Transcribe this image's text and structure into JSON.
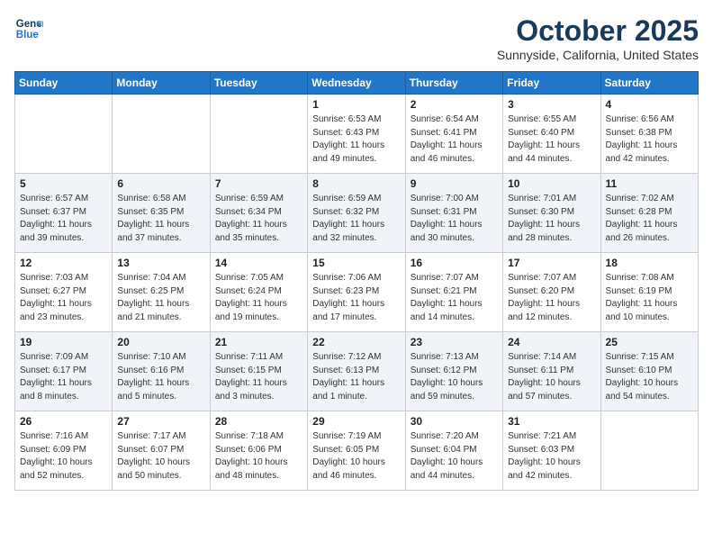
{
  "header": {
    "logo_line1": "General",
    "logo_line2": "Blue",
    "month": "October 2025",
    "location": "Sunnyside, California, United States"
  },
  "days_of_week": [
    "Sunday",
    "Monday",
    "Tuesday",
    "Wednesday",
    "Thursday",
    "Friday",
    "Saturday"
  ],
  "weeks": [
    [
      {
        "day": "",
        "info": ""
      },
      {
        "day": "",
        "info": ""
      },
      {
        "day": "",
        "info": ""
      },
      {
        "day": "1",
        "info": "Sunrise: 6:53 AM\nSunset: 6:43 PM\nDaylight: 11 hours\nand 49 minutes."
      },
      {
        "day": "2",
        "info": "Sunrise: 6:54 AM\nSunset: 6:41 PM\nDaylight: 11 hours\nand 46 minutes."
      },
      {
        "day": "3",
        "info": "Sunrise: 6:55 AM\nSunset: 6:40 PM\nDaylight: 11 hours\nand 44 minutes."
      },
      {
        "day": "4",
        "info": "Sunrise: 6:56 AM\nSunset: 6:38 PM\nDaylight: 11 hours\nand 42 minutes."
      }
    ],
    [
      {
        "day": "5",
        "info": "Sunrise: 6:57 AM\nSunset: 6:37 PM\nDaylight: 11 hours\nand 39 minutes."
      },
      {
        "day": "6",
        "info": "Sunrise: 6:58 AM\nSunset: 6:35 PM\nDaylight: 11 hours\nand 37 minutes."
      },
      {
        "day": "7",
        "info": "Sunrise: 6:59 AM\nSunset: 6:34 PM\nDaylight: 11 hours\nand 35 minutes."
      },
      {
        "day": "8",
        "info": "Sunrise: 6:59 AM\nSunset: 6:32 PM\nDaylight: 11 hours\nand 32 minutes."
      },
      {
        "day": "9",
        "info": "Sunrise: 7:00 AM\nSunset: 6:31 PM\nDaylight: 11 hours\nand 30 minutes."
      },
      {
        "day": "10",
        "info": "Sunrise: 7:01 AM\nSunset: 6:30 PM\nDaylight: 11 hours\nand 28 minutes."
      },
      {
        "day": "11",
        "info": "Sunrise: 7:02 AM\nSunset: 6:28 PM\nDaylight: 11 hours\nand 26 minutes."
      }
    ],
    [
      {
        "day": "12",
        "info": "Sunrise: 7:03 AM\nSunset: 6:27 PM\nDaylight: 11 hours\nand 23 minutes."
      },
      {
        "day": "13",
        "info": "Sunrise: 7:04 AM\nSunset: 6:25 PM\nDaylight: 11 hours\nand 21 minutes."
      },
      {
        "day": "14",
        "info": "Sunrise: 7:05 AM\nSunset: 6:24 PM\nDaylight: 11 hours\nand 19 minutes."
      },
      {
        "day": "15",
        "info": "Sunrise: 7:06 AM\nSunset: 6:23 PM\nDaylight: 11 hours\nand 17 minutes."
      },
      {
        "day": "16",
        "info": "Sunrise: 7:07 AM\nSunset: 6:21 PM\nDaylight: 11 hours\nand 14 minutes."
      },
      {
        "day": "17",
        "info": "Sunrise: 7:07 AM\nSunset: 6:20 PM\nDaylight: 11 hours\nand 12 minutes."
      },
      {
        "day": "18",
        "info": "Sunrise: 7:08 AM\nSunset: 6:19 PM\nDaylight: 11 hours\nand 10 minutes."
      }
    ],
    [
      {
        "day": "19",
        "info": "Sunrise: 7:09 AM\nSunset: 6:17 PM\nDaylight: 11 hours\nand 8 minutes."
      },
      {
        "day": "20",
        "info": "Sunrise: 7:10 AM\nSunset: 6:16 PM\nDaylight: 11 hours\nand 5 minutes."
      },
      {
        "day": "21",
        "info": "Sunrise: 7:11 AM\nSunset: 6:15 PM\nDaylight: 11 hours\nand 3 minutes."
      },
      {
        "day": "22",
        "info": "Sunrise: 7:12 AM\nSunset: 6:13 PM\nDaylight: 11 hours\nand 1 minute."
      },
      {
        "day": "23",
        "info": "Sunrise: 7:13 AM\nSunset: 6:12 PM\nDaylight: 10 hours\nand 59 minutes."
      },
      {
        "day": "24",
        "info": "Sunrise: 7:14 AM\nSunset: 6:11 PM\nDaylight: 10 hours\nand 57 minutes."
      },
      {
        "day": "25",
        "info": "Sunrise: 7:15 AM\nSunset: 6:10 PM\nDaylight: 10 hours\nand 54 minutes."
      }
    ],
    [
      {
        "day": "26",
        "info": "Sunrise: 7:16 AM\nSunset: 6:09 PM\nDaylight: 10 hours\nand 52 minutes."
      },
      {
        "day": "27",
        "info": "Sunrise: 7:17 AM\nSunset: 6:07 PM\nDaylight: 10 hours\nand 50 minutes."
      },
      {
        "day": "28",
        "info": "Sunrise: 7:18 AM\nSunset: 6:06 PM\nDaylight: 10 hours\nand 48 minutes."
      },
      {
        "day": "29",
        "info": "Sunrise: 7:19 AM\nSunset: 6:05 PM\nDaylight: 10 hours\nand 46 minutes."
      },
      {
        "day": "30",
        "info": "Sunrise: 7:20 AM\nSunset: 6:04 PM\nDaylight: 10 hours\nand 44 minutes."
      },
      {
        "day": "31",
        "info": "Sunrise: 7:21 AM\nSunset: 6:03 PM\nDaylight: 10 hours\nand 42 minutes."
      },
      {
        "day": "",
        "info": ""
      }
    ]
  ]
}
